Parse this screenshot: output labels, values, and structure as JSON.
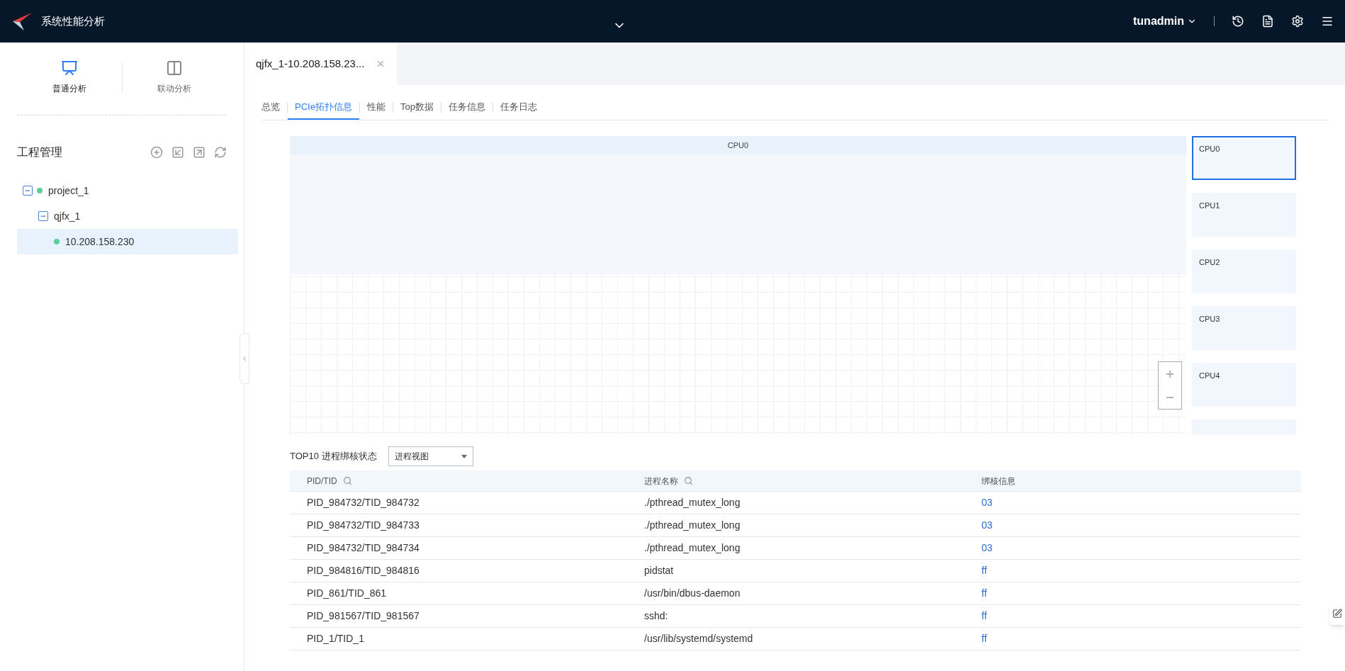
{
  "header": {
    "app_title": "系统性能分析",
    "user": "tunadmin"
  },
  "sidebar": {
    "modes": [
      {
        "label": "普通分析",
        "selected": true
      },
      {
        "label": "联动分析",
        "selected": false
      }
    ],
    "section_title": "工程管理",
    "tree": [
      {
        "label": "project_1",
        "dot": true,
        "expanded": true,
        "selected": false,
        "children": [
          {
            "label": "qjfx_1",
            "expanded": true,
            "selected": false,
            "children": [
              {
                "label": "10.208.158.230",
                "dot": true,
                "selected": false,
                "selected_row": true
              }
            ]
          }
        ]
      }
    ]
  },
  "doc_tab": {
    "label": "qjfx_1-10.208.158.23..."
  },
  "tabs": [
    {
      "label": "总览",
      "selected": false
    },
    {
      "label": "PCIe拓扑信息",
      "selected": true
    },
    {
      "label": "性能",
      "selected": false
    },
    {
      "label": "Top数据",
      "selected": false
    },
    {
      "label": "任务信息",
      "selected": false
    },
    {
      "label": "任务日志",
      "selected": false
    }
  ],
  "topology": {
    "panel_title": "CPU0",
    "cpus": [
      {
        "label": "CPU0",
        "selected": true
      },
      {
        "label": "CPU1",
        "selected": false
      },
      {
        "label": "CPU2",
        "selected": false
      },
      {
        "label": "CPU3",
        "selected": false
      },
      {
        "label": "CPU4",
        "selected": false
      }
    ]
  },
  "table": {
    "title": "TOP10 进程绑核状态",
    "view_select": "进程视图",
    "columns": [
      {
        "label": "PID/TID",
        "searchable": true
      },
      {
        "label": "进程名称",
        "searchable": true
      },
      {
        "label": "绑核信息",
        "searchable": false
      }
    ],
    "rows": [
      [
        "PID_984732/TID_984732",
        "./pthread_mutex_long",
        "03"
      ],
      [
        "PID_984732/TID_984733",
        "./pthread_mutex_long",
        "03"
      ],
      [
        "PID_984732/TID_984734",
        "./pthread_mutex_long",
        "03"
      ],
      [
        "PID_984816/TID_984816",
        "pidstat",
        "ff"
      ],
      [
        "PID_861/TID_861",
        "/usr/bin/dbus-daemon",
        "ff"
      ],
      [
        "PID_981567/TID_981567",
        "sshd:",
        "ff"
      ],
      [
        "PID_1/TID_1",
        "/usr/lib/systemd/systemd",
        "ff"
      ]
    ]
  }
}
